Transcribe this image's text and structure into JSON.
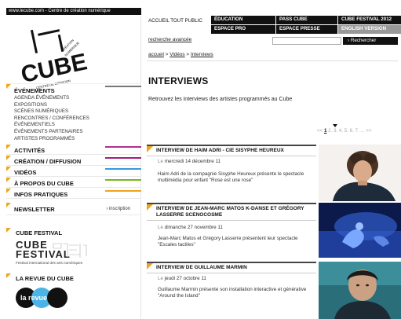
{
  "site_bar": "www.lecube.com - Centre de création numérique",
  "top_nav": {
    "accueil": "ACCUEIL TOUT PUBLIC",
    "education": "ÉDUCATION",
    "pass_cube": "PASS CUBE",
    "festival": "CUBE FESTIVAL 2012",
    "espace_pro": "ESPACE PRO",
    "espace_presse": "ESPACE PRESSE",
    "english": "ENGLISH VERSION"
  },
  "search": {
    "advanced_label": "recherche avancée",
    "button_label": "› Rechercher",
    "value": ""
  },
  "breadcrumb": {
    "home": "accueil",
    "sep": ">",
    "videos": "Vidéos",
    "current": "Interviews"
  },
  "page": {
    "title": "INTERVIEWS",
    "intro": "Retrouvez les interviews des artistes programmés au Cube"
  },
  "pager": {
    "prev": "<<",
    "current": "1",
    "rest": "2. 3. 4. 5. 6. 7. ... >>"
  },
  "sidebar": {
    "evenements_title": "ÉVÉNEMENTS",
    "evenements_items": [
      "AGENDA ÉVÉNEMENTS",
      "EXPOSITIONS",
      "SCÈNES NUMÉRIQUES",
      "RENCONTRES / CONFÉRENCES",
      "ÉVÉNEMENTIELS",
      "ÉVÉNEMENTS PARTENAIRES",
      "ARTISTES PROGRAMMÉS"
    ],
    "nav": [
      {
        "label": "ACTIVITÉS",
        "color": "#b12f8f"
      },
      {
        "label": "CRÉATION / DIFFUSION",
        "color": "#a21f7e"
      },
      {
        "label": "VIDÉOS",
        "color": "#3a9ad9"
      },
      {
        "label": "À PROPOS DU CUBE",
        "color": "#7ab51d"
      },
      {
        "label": "INFOS PRATIQUES",
        "color": "#f0a41d"
      }
    ],
    "newsletter": "NEWSLETTER",
    "inscription": "› inscription",
    "cube_festival_title": "CUBE FESTIVAL",
    "cube_festival_logo_top": "CUBE",
    "cube_festival_logo_bottom": "FESTIVAL",
    "cube_festival_caption": "Festival international des arts numériques",
    "revue_title": "LA REVUE DU CUBE",
    "revue_logo": "la revue"
  },
  "logo": {
    "text": "CUBE",
    "small_text": "CENTRE DE CRÉATION NUMÉRIQUE"
  },
  "interviews": [
    {
      "title": "INTERVIEW DE HAIM ADRI - CIE SISYPHE HEUREUX",
      "date_prefix": "Le",
      "date": "mercredi 14 décembre 11",
      "desc": "Haim Adri de la compagnie Sisyphe Heureux présente le spectacle multimédia pour enfant \"Rose est une rose\""
    },
    {
      "title": "INTERVIEW DE JEAN-MARC MATOS K-DANSE ET GRÉGORY LASSERRE SCENOCOSME",
      "date_prefix": "Le",
      "date": "dimanche 27 novembre 11",
      "desc": "Jean-Marc Matos et Grégory Lasserre présentent leur spectacle \"Escales tactiles\""
    },
    {
      "title": "INTERVIEW DE GUILLAUME MARMIN",
      "date_prefix": "Le",
      "date": "jeudi 27 octobre 11",
      "desc": "Guillaume Marmin présente son installation interactive et générative \"Around the Island\""
    }
  ],
  "colors": {
    "accent": "#f0a41d",
    "black": "#111111"
  }
}
